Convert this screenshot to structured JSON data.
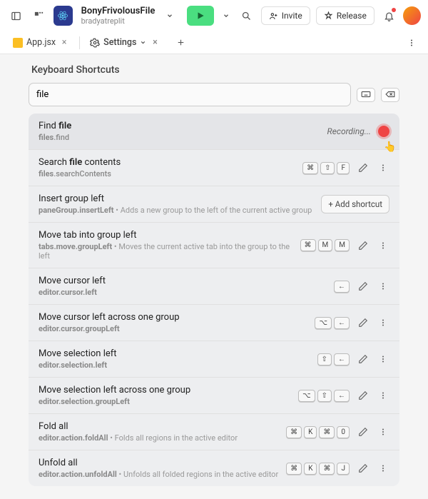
{
  "header": {
    "project_name": "BonyFrivolousFile",
    "project_user": "bradyatreplit",
    "invite_label": "Invite",
    "release_label": "Release"
  },
  "tabs": {
    "file_tab": "App.jsx",
    "settings_tab": "Settings"
  },
  "page": {
    "heading": "Keyboard Shortcuts",
    "search_value": "file",
    "recording_label": "Recording...",
    "add_shortcut_label": "+  Add shortcut"
  },
  "items": [
    {
      "title_pre": "Find ",
      "title_b": "file",
      "title_post": "",
      "cmd_pre": "files",
      "cmd_b": ".find",
      "desc": "",
      "mode": "recording"
    },
    {
      "title_pre": "Search ",
      "title_b": "file",
      "title_post": " contents",
      "cmd_pre": "files",
      "cmd_b": ".searchContents",
      "desc": "",
      "keys": [
        "⌘",
        "⇧",
        "F"
      ],
      "mode": "keys"
    },
    {
      "title_pre": "Insert group left",
      "title_b": "",
      "title_post": "",
      "cmd_pre": "paneGroup.insertLeft",
      "cmd_b": "",
      "desc": "Adds a new group to the left of the current active group",
      "mode": "add"
    },
    {
      "title_pre": "Move tab into group left",
      "title_b": "",
      "title_post": "",
      "cmd_pre": "tabs.move.groupLeft",
      "cmd_b": "",
      "desc": "Moves the current active tab into the group to the left",
      "keys": [
        "⌘",
        "M",
        "M"
      ],
      "mode": "keys"
    },
    {
      "title_pre": "Move cursor left",
      "title_b": "",
      "title_post": "",
      "cmd_pre": "editor.cursor.left",
      "cmd_b": "",
      "desc": "",
      "keys": [
        "←"
      ],
      "mode": "keys"
    },
    {
      "title_pre": "Move cursor left across one group",
      "title_b": "",
      "title_post": "",
      "cmd_pre": "editor.cursor.groupLeft",
      "cmd_b": "",
      "desc": "",
      "keys": [
        "⌥",
        "←"
      ],
      "mode": "keys"
    },
    {
      "title_pre": "Move selection left",
      "title_b": "",
      "title_post": "",
      "cmd_pre": "editor.selection.left",
      "cmd_b": "",
      "desc": "",
      "keys": [
        "⇧",
        "←"
      ],
      "mode": "keys"
    },
    {
      "title_pre": "Move selection left across one group",
      "title_b": "",
      "title_post": "",
      "cmd_pre": "editor.selection.groupLeft",
      "cmd_b": "",
      "desc": "",
      "keys": [
        "⌥",
        "⇧",
        "←"
      ],
      "mode": "keys"
    },
    {
      "title_pre": "Fold all",
      "title_b": "",
      "title_post": "",
      "cmd_pre": "editor.action.foldAll",
      "cmd_b": "",
      "desc": "Folds all regions in the active editor",
      "keys": [
        "⌘",
        "K",
        "⌘",
        "0"
      ],
      "mode": "keys"
    },
    {
      "title_pre": "Unfold all",
      "title_b": "",
      "title_post": "",
      "cmd_pre": "editor.action.unfoldAll",
      "cmd_b": "",
      "desc": "Unfolds all folded regions in the active editor",
      "keys": [
        "⌘",
        "K",
        "⌘",
        "J"
      ],
      "mode": "keys"
    }
  ]
}
